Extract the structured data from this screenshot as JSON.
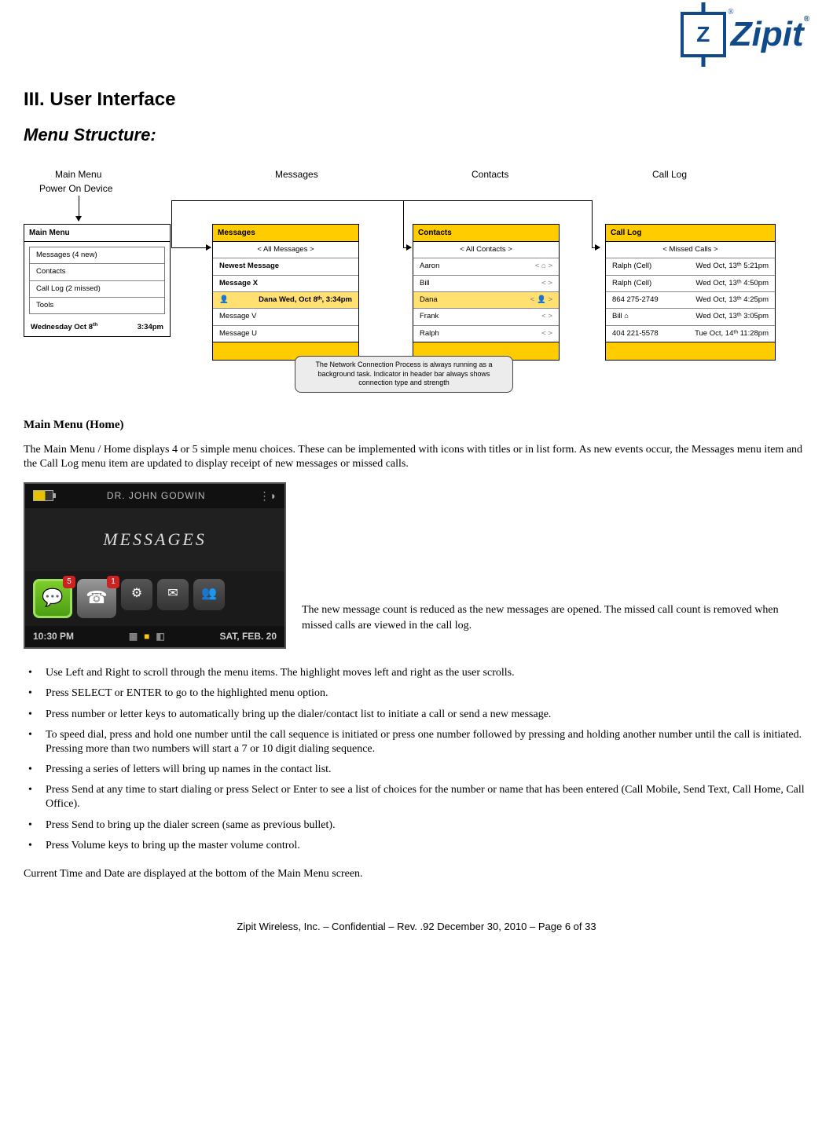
{
  "logo": {
    "letter": "Z",
    "text": "Zipit",
    "reg": "®"
  },
  "h1": "III. User Interface",
  "h2": "Menu Structure:",
  "diagram": {
    "labels": {
      "main": "Main Menu",
      "power": "Power On Device",
      "messages": "Messages",
      "contacts": "Contacts",
      "calllog": "Call Log"
    },
    "main_menu": {
      "title": "Main Menu",
      "items": [
        "Messages   (4 new)",
        "Contacts",
        "Call Log (2 missed)",
        "Tools"
      ],
      "footer_left": "Wednesday Oct 8",
      "footer_left_sup": "th",
      "footer_right": "3:34pm"
    },
    "messages": {
      "title": "Messages",
      "filter": "<  All Messages  >",
      "rows": [
        {
          "text": "Newest Message",
          "bold": true
        },
        {
          "text": "Message X",
          "bold": true
        },
        {
          "text": "Dana    Wed, Oct 8ᵗʰ, 3:34pm",
          "bold": true,
          "sel": true,
          "icon": "👤"
        },
        {
          "text": "Message V"
        },
        {
          "text": "Message U"
        }
      ]
    },
    "contacts": {
      "title": "Contacts",
      "filter": "<   All Contacts   >",
      "rows": [
        {
          "left": "Aaron",
          "right": "<   ⌂   >"
        },
        {
          "left": "Bill",
          "right": "<        >"
        },
        {
          "left": "Dana",
          "right": "<   👤   >",
          "sel": true
        },
        {
          "left": "Frank",
          "right": "<        >"
        },
        {
          "left": "Ralph",
          "right": "<        >"
        }
      ]
    },
    "calllog": {
      "title": "Call Log",
      "filter": "<   Missed Calls  >",
      "rows": [
        {
          "left": "Ralph (Cell)",
          "right": "Wed Oct, 13ᵗʰ 5:21pm"
        },
        {
          "left": "Ralph (Cell)",
          "right": "Wed Oct, 13ᵗʰ 4:50pm"
        },
        {
          "left": "864 275-2749",
          "right": "Wed Oct, 13ᵗʰ 4:25pm"
        },
        {
          "left": "Bill  ⌂",
          "right": "Wed Oct, 13ᵗʰ 3:05pm"
        },
        {
          "left": "404 221-5578",
          "right": "Tue Oct, 14ᵗʰ 11:28pm"
        }
      ]
    },
    "note": "The Network Connection Process is always running as a background task. Indicator in header bar always shows connection type and strength"
  },
  "section_title": "Main Menu (Home)",
  "intro": "The Main Menu / Home displays 4 or 5 simple menu choices.  These can be implemented with icons with titles or in list form.  As new events occur, the Messages menu item and the Call Log menu item are updated to display receipt of new messages or missed calls.",
  "device": {
    "name": "DR. JOHN GODWIN",
    "banner": "MESSAGES",
    "badge1": "5",
    "badge2": "1",
    "time": "10:30 PM",
    "date": "SAT, FEB. 20"
  },
  "caption": "The new message count is reduced as the new messages are opened.  The missed call count is removed when missed calls are viewed in the call log.",
  "bullets": [
    "Use Left and Right to scroll through the menu items.  The highlight moves left and right as the user scrolls.",
    "Press SELECT or ENTER to go to the highlighted menu option.",
    "Press number or letter keys to automatically bring up the dialer/contact list to initiate a call or send a new message.",
    " To speed dial, press and hold one number until the call sequence is initiated or press one number followed by pressing and holding another number until the call is initiated.  Pressing more than two numbers will start a 7 or 10 digit dialing sequence.",
    "Pressing a series of letters will bring up names in the contact list.",
    " Press Send at any time to start dialing or press Select or Enter to see a list of choices for the number or name that has been entered (Call Mobile, Send Text, Call Home, Call Office).",
    " Press Send to bring up the dialer screen (same as previous bullet).",
    "Press Volume keys to bring up the master volume control."
  ],
  "closing": "Current Time and Date are displayed at the bottom of the Main Menu screen.",
  "footer": "Zipit Wireless, Inc. – Confidential – Rev. .92 December 30, 2010 – Page 6 of 33"
}
